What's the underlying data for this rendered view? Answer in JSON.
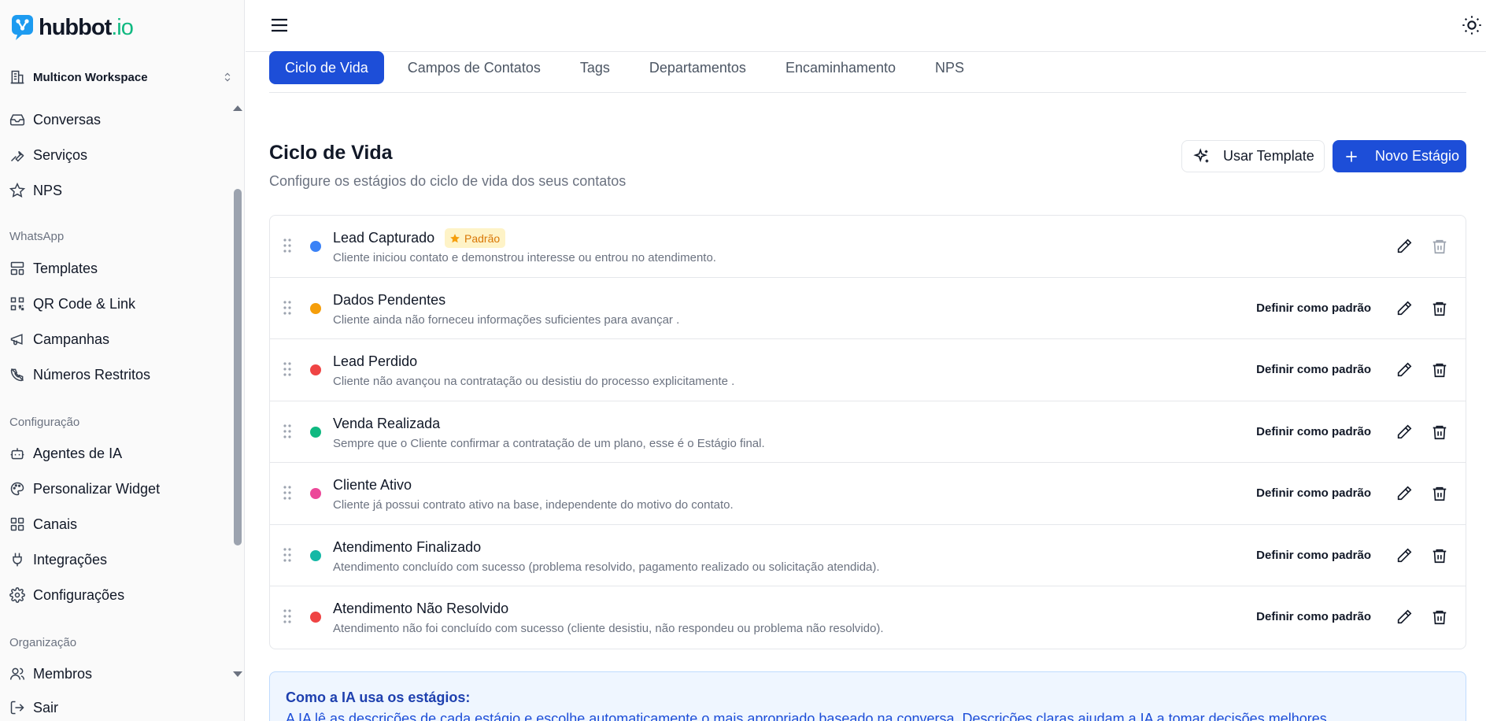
{
  "brand": {
    "name": "hubbot",
    "tld": ".io"
  },
  "workspace": {
    "label": "Multicon Workspace"
  },
  "sidebar": {
    "items_top": [
      {
        "label": "Conversas",
        "icon": "inbox-icon"
      },
      {
        "label": "Serviços",
        "icon": "wrench-icon"
      },
      {
        "label": "NPS",
        "icon": "star-icon"
      }
    ],
    "section_whatsapp": "WhatsApp",
    "items_whatsapp": [
      {
        "label": "Templates",
        "icon": "layout-template-icon"
      },
      {
        "label": "QR Code & Link",
        "icon": "qr-code-icon"
      },
      {
        "label": "Campanhas",
        "icon": "megaphone-icon"
      },
      {
        "label": "Números Restritos",
        "icon": "phone-off-icon"
      }
    ],
    "section_config": "Configuração",
    "items_config": [
      {
        "label": "Agentes de IA",
        "icon": "bot-icon"
      },
      {
        "label": "Personalizar Widget",
        "icon": "palette-icon"
      },
      {
        "label": "Canais",
        "icon": "grid-icon"
      },
      {
        "label": "Integrações",
        "icon": "plug-icon"
      },
      {
        "label": "Configurações",
        "icon": "gear-icon"
      }
    ],
    "section_org": "Organização",
    "items_org": [
      {
        "label": "Membros",
        "icon": "users-icon"
      }
    ],
    "logout": "Sair"
  },
  "tabs": [
    {
      "label": "Ciclo de Vida",
      "active": true
    },
    {
      "label": "Campos de Contatos"
    },
    {
      "label": "Tags"
    },
    {
      "label": "Departamentos"
    },
    {
      "label": "Encaminhamento"
    },
    {
      "label": "NPS"
    }
  ],
  "header": {
    "title": "Ciclo de Vida",
    "subtitle": "Configure os estágios do ciclo de vida dos seus contatos",
    "template_button": "Usar Template",
    "new_button": "Novo Estágio"
  },
  "default_badge": "Padrão",
  "set_default_label": "Definir como padrão",
  "stages": [
    {
      "name": "Lead Capturado",
      "desc": "Cliente iniciou contato e demonstrou interesse ou entrou no atendimento.",
      "color": "#3b82f6",
      "is_default": true
    },
    {
      "name": "Dados Pendentes",
      "desc": "Cliente ainda não forneceu informações suficientes para avançar .",
      "color": "#f59e0b"
    },
    {
      "name": "Lead Perdido",
      "desc": "Cliente não avançou na contratação ou desistiu do processo explicitamente .",
      "color": "#ef4444"
    },
    {
      "name": "Venda Realizada",
      "desc": "Sempre que o Cliente confirmar a contratação de um plano, esse é o Estágio final.",
      "color": "#10b981"
    },
    {
      "name": "Cliente Ativo",
      "desc": "Cliente já possui contrato ativo na base, independente do motivo do contato.",
      "color": "#ec4899"
    },
    {
      "name": "Atendimento Finalizado",
      "desc": "Atendimento concluído com sucesso (problema resolvido, pagamento realizado ou solicitação atendida).",
      "color": "#14b8a6"
    },
    {
      "name": "Atendimento Não Resolvido",
      "desc": "Atendimento não foi concluído com sucesso (cliente desistiu, não respondeu ou problema não resolvido).",
      "color": "#ef4444"
    }
  ],
  "info": {
    "title": "Como a IA usa os estágios:",
    "text": "A IA lê as descrições de cada estágio e escolhe automaticamente o mais apropriado baseado na conversa. Descrições claras ajudam a IA a tomar decisões melhores."
  }
}
